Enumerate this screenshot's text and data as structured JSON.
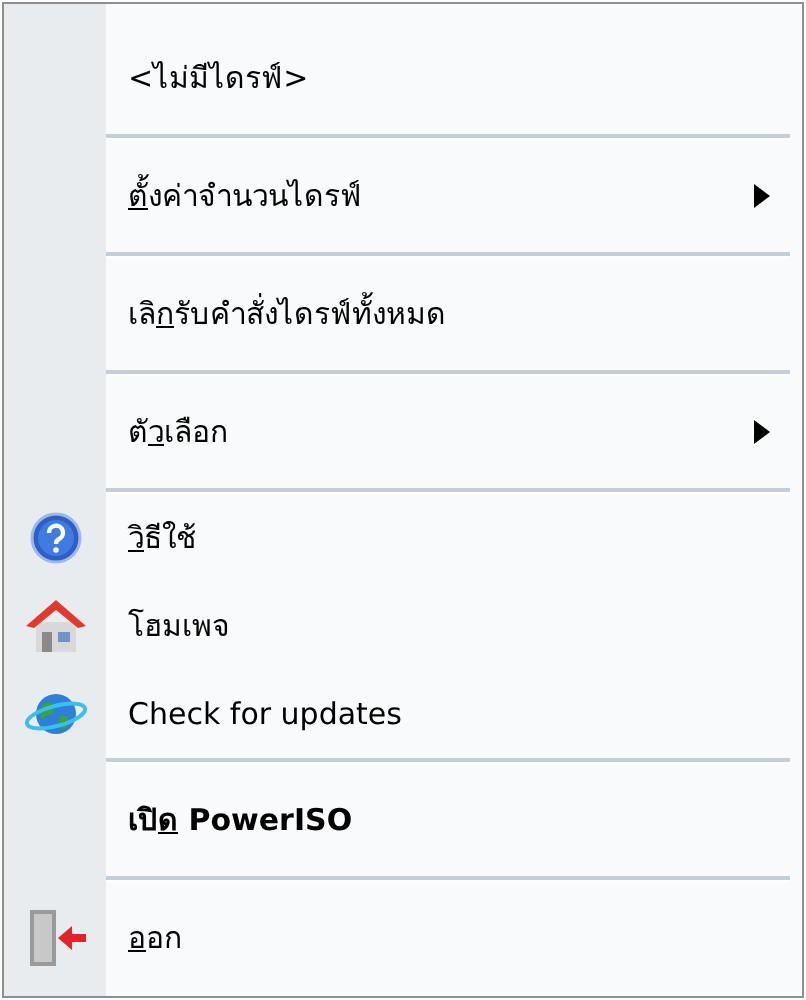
{
  "menu": [
    {
      "kind": "item",
      "label": {
        "pre": "<ไม่มีไดรฟ์>"
      },
      "submenu": false,
      "bold": false
    },
    {
      "kind": "separator"
    },
    {
      "kind": "item",
      "label": {
        "key": "ต",
        "post": "ั้งค่าจำนวนไดรฟ์"
      },
      "submenu": true,
      "bold": false
    },
    {
      "kind": "separator"
    },
    {
      "kind": "item",
      "label": {
        "pre": "เลิ",
        "key": "ก",
        "post": "รับคำสั่งไดรฟ์ทั้งหมด"
      },
      "submenu": false,
      "bold": false
    },
    {
      "kind": "separator"
    },
    {
      "kind": "item",
      "label": {
        "pre": "ตั",
        "key": "ว",
        "post": "เลือก"
      },
      "submenu": true,
      "bold": false
    },
    {
      "kind": "separator"
    },
    {
      "kind": "help",
      "label": {
        "key": "ว",
        "post": "ิธีใช้"
      },
      "submenu": false,
      "bold": false
    },
    {
      "kind": "home",
      "label": {
        "pre": "โฮมเพจ"
      },
      "submenu": false,
      "bold": false
    },
    {
      "kind": "update",
      "label": {
        "pre": "Check for updates"
      },
      "submenu": false,
      "bold": false
    },
    {
      "kind": "separator"
    },
    {
      "kind": "item",
      "label": {
        "pre": "เปิ",
        "key": "ด",
        "post": " PowerISO"
      },
      "submenu": false,
      "bold": true
    },
    {
      "kind": "separator"
    },
    {
      "kind": "exit",
      "label": {
        "key": "อ",
        "post": "อก"
      },
      "submenu": false,
      "bold": false
    }
  ]
}
